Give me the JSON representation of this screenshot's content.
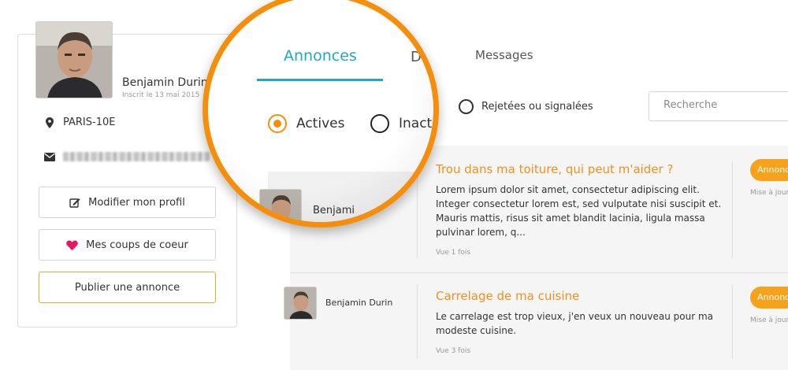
{
  "profile": {
    "name": "Benjamin Durin",
    "signup_date": "Inscrit le 13 mai 2015",
    "location": "PARIS-10E",
    "buttons": {
      "edit_profile": "Modifier mon profil",
      "favorites": "Mes coups de coeur",
      "publish": "Publier une annonce"
    }
  },
  "tabs": [
    {
      "label": "Annonces",
      "active": true
    },
    {
      "label": "Dd",
      "active": false
    },
    {
      "label": "Messages",
      "active": false
    }
  ],
  "magnifier": {
    "tab_active": "Annonces",
    "tab_partial": "Des",
    "radio_active": "Actives",
    "radio_inactive": "Inact",
    "author_partial": "Benjami"
  },
  "filters": {
    "rejected_label": "Rejetées ou signalées",
    "search_placeholder": "Recherche"
  },
  "ads": [
    {
      "author": "Benjamin",
      "title": "Trou dans ma toiture, qui peut m'aider ?",
      "description": "Lorem ipsum dolor sit amet, consectetur adipiscing elit. Integer consectetur lorem est, sed vulputate nisi suscipit et. Mauris mattis, risus sit amet blandit lacinia, ligula massa pulvinar lorem, q...",
      "views": "Vue 1 fois",
      "badge": "Annonce",
      "update": "Mise à jour"
    },
    {
      "author": "Benjamin Durin",
      "title": "Carrelage de ma cuisine",
      "description": "Le carrelage est trop vieux, j'en veux un nouveau pour ma modeste cuisine.",
      "views": "Vue 3 fois",
      "badge": "Annonce",
      "update": "Mise à jour"
    }
  ],
  "colors": {
    "accent_orange": "#f58f0b",
    "tab_blue": "#20a7c6",
    "badge_orange": "#f7a21b",
    "title_orange": "#f0911e"
  }
}
